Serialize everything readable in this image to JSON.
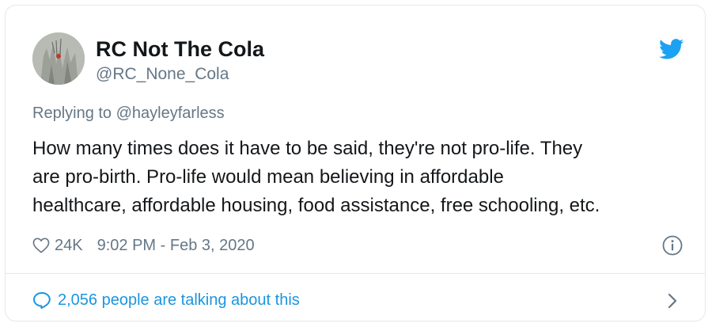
{
  "tweet": {
    "author_name": "RC Not The Cola",
    "author_handle": "@RC_None_Cola",
    "replying_prefix": "Replying to",
    "replying_to": "@hayleyfarless",
    "text_lines": [
      "How many times does it have to be said, they're not pro-life. They",
      "are pro-birth. Pro-life would mean believing in affordable",
      "healthcare, affordable housing, food assistance, free schooling, etc."
    ],
    "likes": "24K",
    "timestamp": "9:02 PM - Feb 3, 2020",
    "talking": "2,056 people are talking about this"
  },
  "icons": {
    "brand": "twitter-bird-icon",
    "like": "heart-outline-icon",
    "info": "info-circle-icon",
    "reply": "speech-bubble-icon",
    "more": "chevron-right-icon"
  },
  "colors": {
    "brand_blue": "#1da1f2",
    "link_blue": "#1b95e0",
    "secondary_text": "#657786",
    "primary_text": "#14171a",
    "border": "#e1e8ed"
  }
}
